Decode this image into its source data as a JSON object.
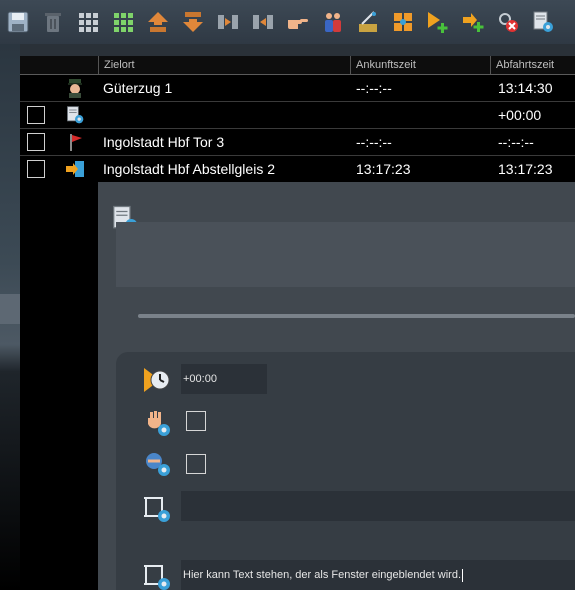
{
  "toolbar": {
    "buttons": [
      {
        "name": "save-icon"
      },
      {
        "name": "trash-icon"
      },
      {
        "name": "grid-gray-icon"
      },
      {
        "name": "grid-green-icon"
      },
      {
        "name": "move-up-icon"
      },
      {
        "name": "move-down-icon"
      },
      {
        "name": "insert-before-icon"
      },
      {
        "name": "insert-after-icon"
      },
      {
        "name": "pointing-hand-icon"
      },
      {
        "name": "people-icon"
      },
      {
        "name": "signal-tool-icon"
      },
      {
        "name": "arrows-grid-icon"
      },
      {
        "name": "play-add-icon"
      },
      {
        "name": "arrow-add-icon"
      },
      {
        "name": "remove-link-icon"
      },
      {
        "name": "settings-doc-icon"
      }
    ]
  },
  "table": {
    "headers": [
      "",
      "",
      "Zielort",
      "Ankunftszeit",
      "Abfahrtszeit"
    ],
    "rows": [
      {
        "checkbox": false,
        "icon": "conductor-icon",
        "destination": "Güterzug 1",
        "arrival": "--:--:--",
        "departure": "13:14:30"
      },
      {
        "checkbox": true,
        "icon": "settings-doc-icon",
        "destination": "",
        "arrival": "",
        "departure": "+00:00"
      },
      {
        "checkbox": true,
        "icon": "flag-icon",
        "destination": "Ingolstadt Hbf Tor 3",
        "arrival": "--:--:--",
        "departure": "--:--:--"
      },
      {
        "checkbox": true,
        "icon": "arrow-enter-icon",
        "destination": "Ingolstadt Hbf Abstellgleis 2",
        "arrival": "13:17:23",
        "departure": "13:17:23"
      }
    ]
  },
  "panel": {
    "time_offset": "+00:00",
    "stop_checkbox": false,
    "shunt_checkbox": false,
    "text_field_1": "",
    "message_text": "Hier kann Text stehen, der als Fenster eingeblendet wird."
  }
}
